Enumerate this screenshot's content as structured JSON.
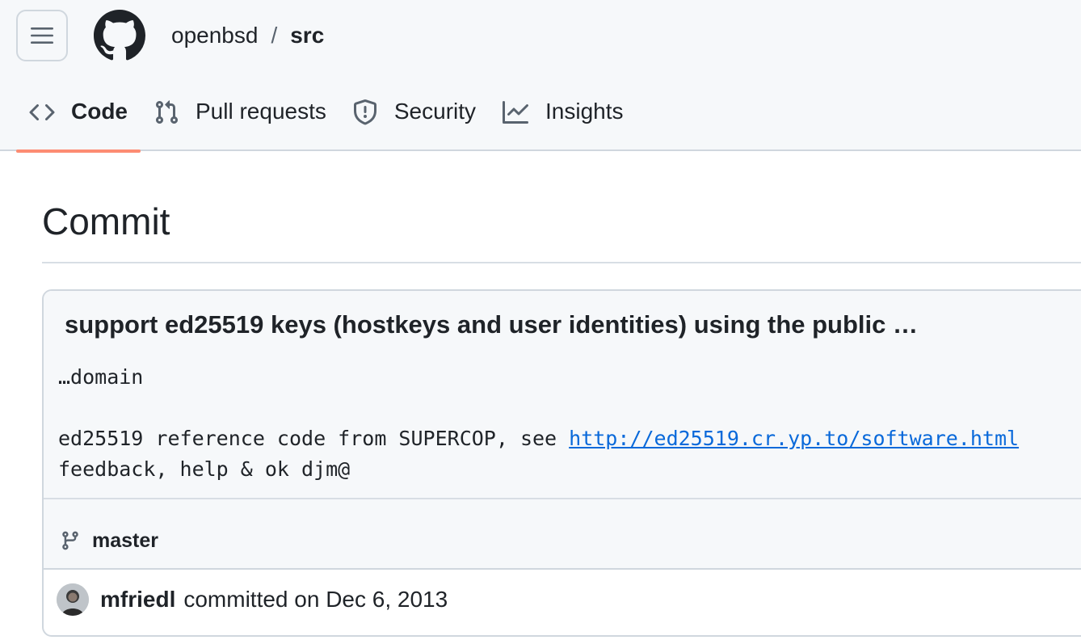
{
  "header": {
    "owner": "openbsd",
    "separator": "/",
    "repo": "src",
    "menu_icon": "hamburger-icon",
    "logo_icon": "github-logo-icon"
  },
  "tabs": [
    {
      "label": "Code",
      "icon": "code-icon",
      "active": true
    },
    {
      "label": "Pull requests",
      "icon": "git-pull-request-icon",
      "active": false
    },
    {
      "label": "Security",
      "icon": "shield-icon",
      "active": false
    },
    {
      "label": "Insights",
      "icon": "graph-icon",
      "active": false
    }
  ],
  "page": {
    "title": "Commit"
  },
  "commit": {
    "title": "support ed25519 keys (hostkeys and user identities) using the public …",
    "body_line1": "…domain",
    "body_line2_prefix": "ed25519 reference code from SUPERCOP, see ",
    "body_link": "http://ed25519.cr.yp.to/software.html",
    "body_line3": "feedback, help & ok djm@",
    "branch": "master",
    "branch_icon": "git-branch-icon",
    "author": "mfriedl",
    "committed_text": "committed on Dec 6, 2013"
  },
  "colors": {
    "accent_underline": "#fd8c73",
    "link": "#0969da",
    "header_bg": "#f6f8fa",
    "border": "#d0d7de"
  }
}
